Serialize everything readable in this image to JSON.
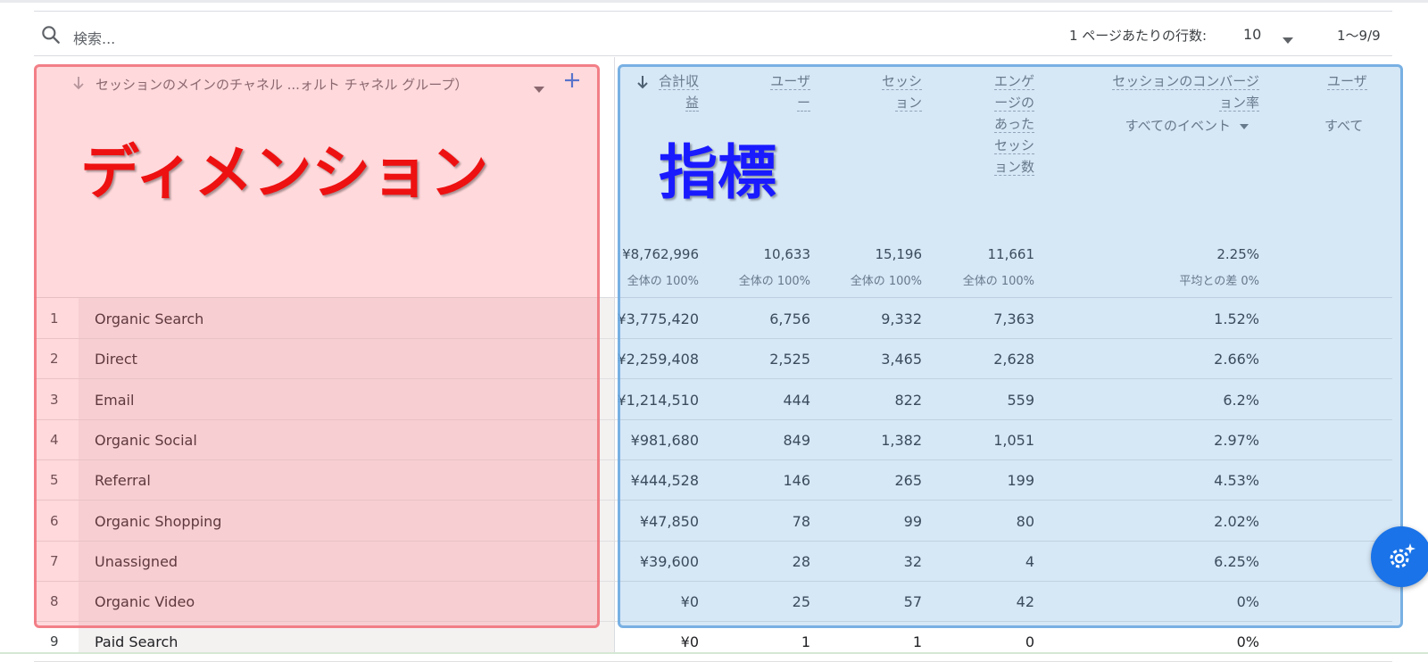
{
  "toolbar": {
    "search_placeholder": "検索...",
    "rows_per_page_label": "1 ページあたりの行数:",
    "rows_per_page_value": "10",
    "pagination": "1〜9/9"
  },
  "dimension": {
    "header": "セッションのメインのチャネル ...ォルト チャネル グループ）",
    "annotation_label": "ディメンション"
  },
  "metrics_annotation_label": "指標",
  "columns": [
    {
      "lines": [
        "合計収",
        "益"
      ],
      "sub": "",
      "total": "¥8,762,996",
      "total_sub": "全体の 100%"
    },
    {
      "lines": [
        "ユーザ",
        "ー"
      ],
      "sub": "",
      "total": "10,633",
      "total_sub": "全体の 100%"
    },
    {
      "lines": [
        "セッシ",
        "ョン"
      ],
      "sub": "",
      "total": "15,196",
      "total_sub": "全体の 100%"
    },
    {
      "lines": [
        "エンゲ",
        "ージの",
        "あった",
        "セッシ",
        "ョン数"
      ],
      "sub": "",
      "total": "11,661",
      "total_sub": "全体の 100%"
    },
    {
      "lines": [
        "セッションのコンバージ",
        "ョン率"
      ],
      "sub": "すべてのイベント",
      "total": "2.25%",
      "total_sub": "平均との差 0%"
    },
    {
      "lines": [
        "ユーザ"
      ],
      "sub": "すべて",
      "total": "",
      "total_sub": ""
    }
  ],
  "rows": [
    {
      "idx": "1",
      "name": "Organic Search",
      "values": [
        "¥3,775,420",
        "6,756",
        "9,332",
        "7,363",
        "1.52%"
      ]
    },
    {
      "idx": "2",
      "name": "Direct",
      "values": [
        "¥2,259,408",
        "2,525",
        "3,465",
        "2,628",
        "2.66%"
      ]
    },
    {
      "idx": "3",
      "name": "Email",
      "values": [
        "¥1,214,510",
        "444",
        "822",
        "559",
        "6.2%"
      ]
    },
    {
      "idx": "4",
      "name": "Organic Social",
      "values": [
        "¥981,680",
        "849",
        "1,382",
        "1,051",
        "2.97%"
      ]
    },
    {
      "idx": "5",
      "name": "Referral",
      "values": [
        "¥444,528",
        "146",
        "265",
        "199",
        "4.53%"
      ]
    },
    {
      "idx": "6",
      "name": "Organic Shopping",
      "values": [
        "¥47,850",
        "78",
        "99",
        "80",
        "2.02%"
      ]
    },
    {
      "idx": "7",
      "name": "Unassigned",
      "values": [
        "¥39,600",
        "28",
        "32",
        "4",
        "6.25%"
      ]
    },
    {
      "idx": "8",
      "name": "Organic Video",
      "values": [
        "¥0",
        "25",
        "57",
        "42",
        "0%"
      ]
    },
    {
      "idx": "9",
      "name": "Paid Search",
      "values": [
        "¥0",
        "1",
        "1",
        "0",
        "0%"
      ]
    }
  ],
  "colors": {
    "dimension_overlay": "#ff7882",
    "metrics_overlay": "#78afe1",
    "dimension_label": "#ee1111",
    "metrics_label": "#1a1aff",
    "fab": "#1a73e8"
  },
  "icons": {
    "search": "search-icon",
    "sort": "arrow-down-icon",
    "add": "plus-icon",
    "fab": "settings-sparkle-icon"
  }
}
